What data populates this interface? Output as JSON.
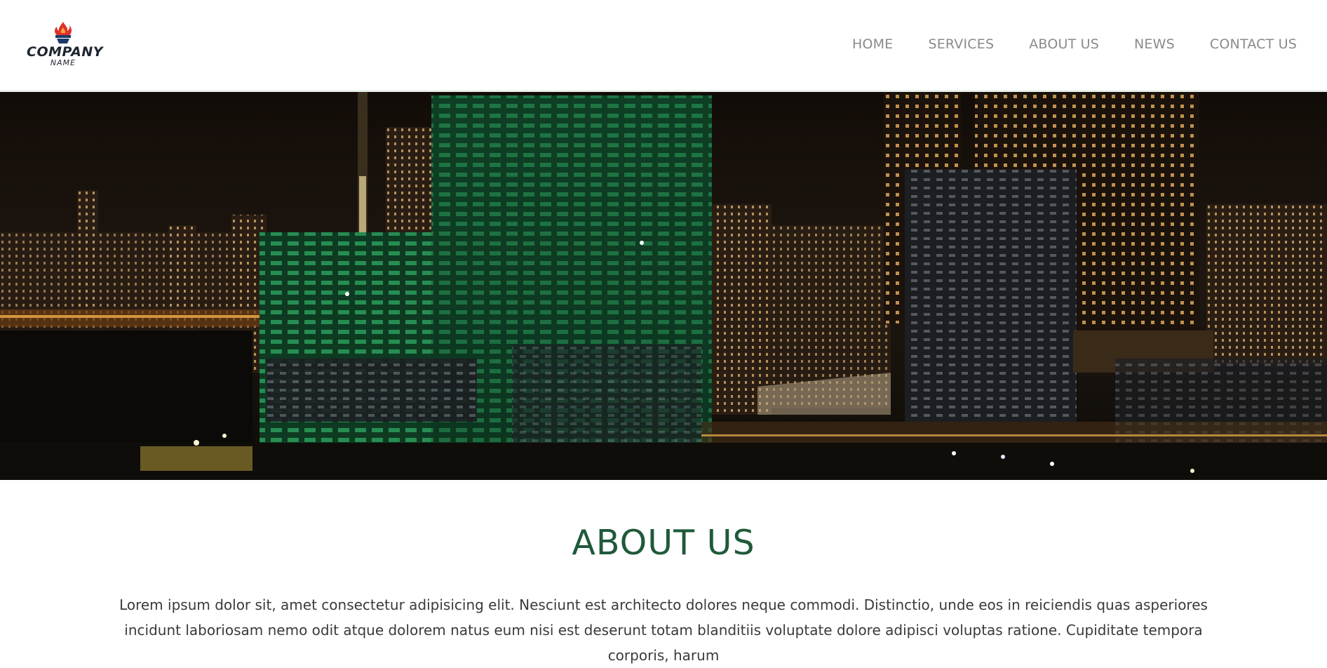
{
  "brand": {
    "name": "COMPANY",
    "sub": "NAME",
    "logo_icon": "flame-icon",
    "flame_color": "#e0312b",
    "base_color": "#1e3a6b"
  },
  "nav": {
    "items": [
      {
        "label": "HOME"
      },
      {
        "label": "SERVICES"
      },
      {
        "label": "ABOUT US"
      },
      {
        "label": "NEWS"
      },
      {
        "label": "CONTACT US"
      }
    ]
  },
  "hero": {
    "image": "night-city-construction-skyline"
  },
  "about": {
    "title": "ABOUT US",
    "text": "Lorem ipsum dolor sit, amet consectetur adipisicing elit. Nesciunt est architecto dolores neque commodi. Distinctio, unde eos in reiciendis quas asperiores incidunt laboriosam nemo odit atque dolorem natus eum nisi est deserunt totam blanditiis voluptate dolore adipisci voluptas ratione. Cupiditate tempora corporis, harum"
  },
  "colors": {
    "accent": "#1f5a3a",
    "nav_text": "#8a8a8a",
    "logo_text": "#1f2630"
  }
}
